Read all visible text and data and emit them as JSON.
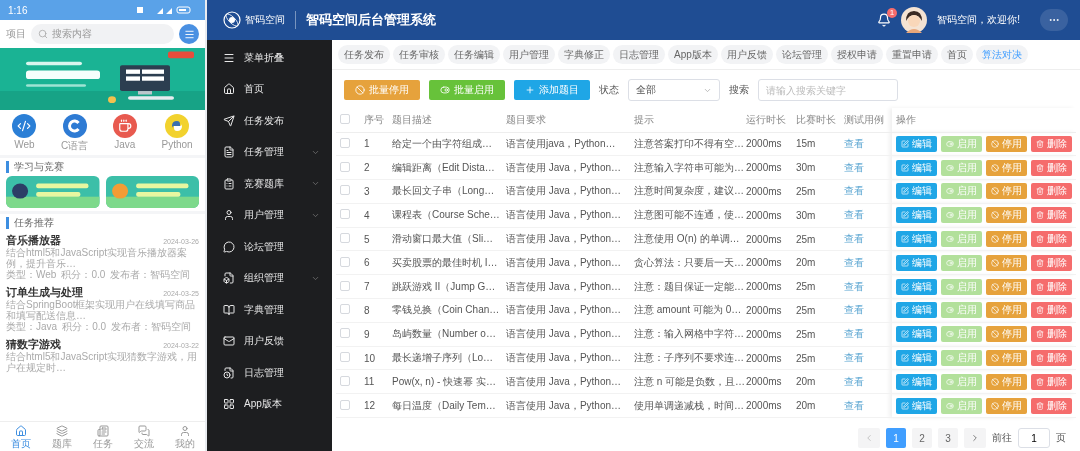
{
  "phone": {
    "status_time": "1:16",
    "search": {
      "label": "项目",
      "placeholder": "搜索内容"
    },
    "categories": [
      {
        "label": "Web",
        "color": "#2b7fd6"
      },
      {
        "label": "C语言",
        "color": "#2e7bd4"
      },
      {
        "label": "Java",
        "color": "#e85a4f"
      },
      {
        "label": "Python",
        "color": "#f2d22e"
      }
    ],
    "study_section": {
      "title": "学习与竞赛"
    },
    "tasks_section": {
      "title": "任务推荐",
      "items": [
        {
          "title": "音乐播放器",
          "date": "2024-03-26",
          "description": "结合html5和JavaScript实现音乐播放器案例，提升音乐…",
          "meta": [
            "类型：Web",
            "积分：0.0",
            "发布者：智码空间"
          ]
        },
        {
          "title": "订单生成与处理",
          "date": "2024-03-25",
          "description": "结合SpringBoot框架实现用户在线填写商品和填写配送信息…",
          "meta": [
            "类型：Java",
            "积分：0.0",
            "发布者：智码空间"
          ]
        },
        {
          "title": "猜数字游戏",
          "date": "2024-03-22",
          "description": "结合html5和JavaScript实现猜数字游戏，用户在规定时…"
        }
      ]
    },
    "bottom_nav": [
      {
        "label": "首页",
        "selected": true
      },
      {
        "label": "题库",
        "selected": false
      },
      {
        "label": "任务",
        "selected": false
      },
      {
        "label": "交流",
        "selected": false
      },
      {
        "label": "我的",
        "selected": false
      }
    ]
  },
  "admin": {
    "header": {
      "logo_text": "智码空间",
      "title": "智码空间后台管理系统",
      "notification_count": "1",
      "greeting": "智码空间，欢迎你!"
    },
    "sidebar": {
      "items": [
        {
          "label": "菜单折叠",
          "kind": "toggle"
        },
        {
          "label": "首页",
          "kind": "link"
        },
        {
          "label": "任务发布",
          "kind": "link"
        },
        {
          "label": "任务管理",
          "kind": "group"
        },
        {
          "label": "竞赛题库",
          "kind": "group"
        },
        {
          "label": "用户管理",
          "kind": "group"
        },
        {
          "label": "论坛管理",
          "kind": "link"
        },
        {
          "label": "组织管理",
          "kind": "group"
        },
        {
          "label": "字典管理",
          "kind": "link"
        },
        {
          "label": "用户反馈",
          "kind": "link"
        },
        {
          "label": "日志管理",
          "kind": "link"
        },
        {
          "label": "App版本",
          "kind": "link"
        }
      ]
    },
    "tabs": [
      {
        "label": "任务发布",
        "selected": false
      },
      {
        "label": "任务审核",
        "selected": false
      },
      {
        "label": "任务编辑",
        "selected": false
      },
      {
        "label": "用户管理",
        "selected": false
      },
      {
        "label": "字典修正",
        "selected": false
      },
      {
        "label": "日志管理",
        "selected": false
      },
      {
        "label": "App版本",
        "selected": false
      },
      {
        "label": "用户反馈",
        "selected": false
      },
      {
        "label": "论坛管理",
        "selected": false
      },
      {
        "label": "授权申请",
        "selected": false
      },
      {
        "label": "重置申请",
        "selected": false
      },
      {
        "label": "首页",
        "selected": false
      },
      {
        "label": "算法对决",
        "selected": true
      }
    ],
    "toolbar": {
      "buttons": [
        {
          "label": "批量停用",
          "kind": "disable"
        },
        {
          "label": "批量启用",
          "kind": "enable"
        },
        {
          "label": "添加题目",
          "kind": "add"
        }
      ],
      "status_label": "状态",
      "status_value": "全部",
      "search_label": "搜索",
      "search_placeholder": "请输入搜索关键字"
    },
    "table": {
      "header_checked": false,
      "columns": [
        "序号",
        "题目描述",
        "题目要求",
        "提示",
        "运行时长",
        "比赛时长",
        "测试用例",
        "操作"
      ],
      "rows": [
        {
          "checked": false,
          "cells": [
            "1",
            "给定一个由字符组成…",
            "语言使用java，Python…",
            "注意答案打印不得有空…",
            "2000ms",
            "15m",
            "查看"
          ],
          "actions": [
            {
              "label": "编辑",
              "kind": "edit",
              "disabled": false
            },
            {
              "label": "启用",
              "kind": "enable",
              "disabled": true
            },
            {
              "label": "停用",
              "kind": "disable",
              "disabled": false
            },
            {
              "label": "删除",
              "kind": "delete",
              "disabled": false
            }
          ]
        },
        {
          "checked": false,
          "cells": [
            "2",
            "编辑距离（Edit Dista…",
            "语言使用 Java，Python…",
            "注意输入字符串可能为…",
            "2000ms",
            "30m",
            "查看"
          ],
          "actions": [
            {
              "label": "编辑",
              "kind": "edit",
              "disabled": false
            },
            {
              "label": "启用",
              "kind": "enable",
              "disabled": true
            },
            {
              "label": "停用",
              "kind": "disable",
              "disabled": false
            },
            {
              "label": "删除",
              "kind": "delete",
              "disabled": false
            }
          ]
        },
        {
          "checked": false,
          "cells": [
            "3",
            "最长回文子串（Long…",
            "语言使用 Java，Python…",
            "注意时间复杂度，建议…",
            "2000ms",
            "25m",
            "查看"
          ],
          "actions": [
            {
              "label": "编辑",
              "kind": "edit",
              "disabled": false
            },
            {
              "label": "启用",
              "kind": "enable",
              "disabled": true
            },
            {
              "label": "停用",
              "kind": "disable",
              "disabled": false
            },
            {
              "label": "删除",
              "kind": "delete",
              "disabled": false
            }
          ]
        },
        {
          "checked": false,
          "cells": [
            "4",
            "课程表（Course Sche…",
            "语言使用 Java，Python…",
            "注意图可能不连通，使…",
            "2000ms",
            "30m",
            "查看"
          ],
          "actions": [
            {
              "label": "编辑",
              "kind": "edit",
              "disabled": false
            },
            {
              "label": "启用",
              "kind": "enable",
              "disabled": true
            },
            {
              "label": "停用",
              "kind": "disable",
              "disabled": false
            },
            {
              "label": "删除",
              "kind": "delete",
              "disabled": false
            }
          ]
        },
        {
          "checked": false,
          "cells": [
            "5",
            "滑动窗口最大值（Sli…",
            "语言使用 Java，Python…",
            "注意使用 O(n) 的单调…",
            "2000ms",
            "25m",
            "查看"
          ],
          "actions": [
            {
              "label": "编辑",
              "kind": "edit",
              "disabled": false
            },
            {
              "label": "启用",
              "kind": "enable",
              "disabled": true
            },
            {
              "label": "停用",
              "kind": "disable",
              "disabled": false
            },
            {
              "label": "删除",
              "kind": "delete",
              "disabled": false
            }
          ]
        },
        {
          "checked": false,
          "cells": [
            "6",
            "买卖股票的最佳时机 I…",
            "语言使用 Java，Python…",
            "贪心算法：只要后一天…",
            "2000ms",
            "20m",
            "查看"
          ],
          "actions": [
            {
              "label": "编辑",
              "kind": "edit",
              "disabled": false
            },
            {
              "label": "启用",
              "kind": "enable",
              "disabled": true
            },
            {
              "label": "停用",
              "kind": "disable",
              "disabled": false
            },
            {
              "label": "删除",
              "kind": "delete",
              "disabled": false
            }
          ]
        },
        {
          "checked": false,
          "cells": [
            "7",
            "跳跃游戏 II（Jump G…",
            "语言使用 Java，Python…",
            "注意：题目保证一定能…",
            "2000ms",
            "25m",
            "查看"
          ],
          "actions": [
            {
              "label": "编辑",
              "kind": "edit",
              "disabled": false
            },
            {
              "label": "启用",
              "kind": "enable",
              "disabled": true
            },
            {
              "label": "停用",
              "kind": "disable",
              "disabled": false
            },
            {
              "label": "删除",
              "kind": "delete",
              "disabled": false
            }
          ]
        },
        {
          "checked": false,
          "cells": [
            "8",
            "零钱兑换（Coin Chan…",
            "语言使用 Java，Python…",
            "注意 amount 可能为 0…",
            "2000ms",
            "25m",
            "查看"
          ],
          "actions": [
            {
              "label": "编辑",
              "kind": "edit",
              "disabled": false
            },
            {
              "label": "启用",
              "kind": "enable",
              "disabled": true
            },
            {
              "label": "停用",
              "kind": "disable",
              "disabled": false
            },
            {
              "label": "删除",
              "kind": "delete",
              "disabled": false
            }
          ]
        },
        {
          "checked": false,
          "cells": [
            "9",
            "岛屿数量（Number o…",
            "语言使用 Java，Python…",
            "注意：输入网格中字符…",
            "2000ms",
            "25m",
            "查看"
          ],
          "actions": [
            {
              "label": "编辑",
              "kind": "edit",
              "disabled": false
            },
            {
              "label": "启用",
              "kind": "enable",
              "disabled": true
            },
            {
              "label": "停用",
              "kind": "disable",
              "disabled": false
            },
            {
              "label": "删除",
              "kind": "delete",
              "disabled": false
            }
          ]
        },
        {
          "checked": false,
          "cells": [
            "10",
            "最长递增子序列（Lo…",
            "语言使用 Java，Python…",
            "注意：子序列不要求连…",
            "2000ms",
            "25m",
            "查看"
          ],
          "actions": [
            {
              "label": "编辑",
              "kind": "edit",
              "disabled": false
            },
            {
              "label": "启用",
              "kind": "enable",
              "disabled": true
            },
            {
              "label": "停用",
              "kind": "disable",
              "disabled": false
            },
            {
              "label": "删除",
              "kind": "delete",
              "disabled": false
            }
          ]
        },
        {
          "checked": false,
          "cells": [
            "11",
            "Pow(x, n) - 快速幂 实…",
            "语言使用 Java，Python…",
            "注意 n 可能是负数，且…",
            "2000ms",
            "20m",
            "查看"
          ],
          "actions": [
            {
              "label": "编辑",
              "kind": "edit",
              "disabled": false
            },
            {
              "label": "启用",
              "kind": "enable",
              "disabled": true
            },
            {
              "label": "停用",
              "kind": "disable",
              "disabled": false
            },
            {
              "label": "删除",
              "kind": "delete",
              "disabled": false
            }
          ]
        },
        {
          "checked": false,
          "cells": [
            "12",
            "每日温度（Daily Tem…",
            "语言使用 Java，Python…",
            "使用单调递减栈，时间…",
            "2000ms",
            "20m",
            "查看"
          ],
          "actions": [
            {
              "label": "编辑",
              "kind": "edit",
              "disabled": false
            },
            {
              "label": "启用",
              "kind": "enable",
              "disabled": true
            },
            {
              "label": "停用",
              "kind": "disable",
              "disabled": false
            },
            {
              "label": "删除",
              "kind": "delete",
              "disabled": false
            }
          ]
        }
      ]
    },
    "pagination": {
      "pages": [
        {
          "label": "1",
          "selected": true
        },
        {
          "label": "2",
          "selected": false
        },
        {
          "label": "3",
          "selected": false
        }
      ],
      "goto_label": "前往",
      "goto_value": "1",
      "page_suffix": "页"
    }
  }
}
